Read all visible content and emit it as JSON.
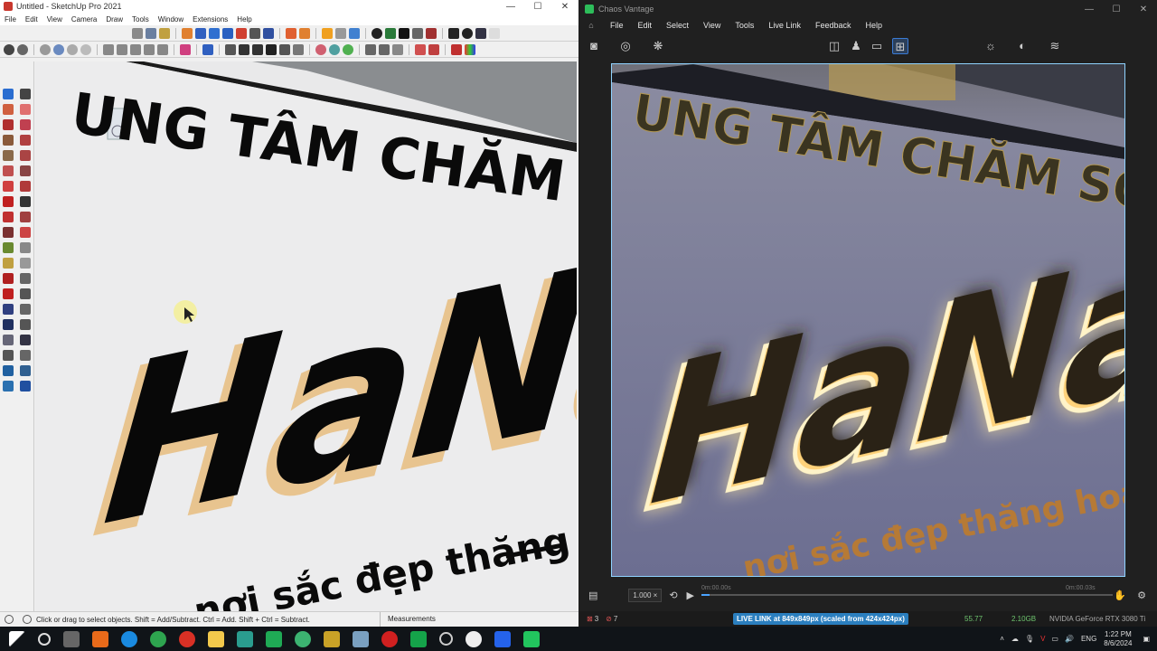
{
  "sketchup": {
    "title": "Untitled - SketchUp Pro 2021",
    "window_controls": [
      "—",
      "☐",
      "✕"
    ],
    "menu": [
      "File",
      "Edit",
      "View",
      "Camera",
      "Draw",
      "Tools",
      "Window",
      "Extensions",
      "Help"
    ],
    "status_text": "Click or drag to select objects. Shift = Add/Subtract. Ctrl = Add. Shift + Ctrl = Subtract.",
    "measurements_label": "Measurements"
  },
  "sign": {
    "heading": "UNG TÂM CHĂM SÓC S",
    "brand": "HaNa Sp",
    "tagline": "nơi sắc đẹp thăng hoa"
  },
  "vantage": {
    "title": "Chaos Vantage",
    "menu": [
      "File",
      "Edit",
      "Select",
      "View",
      "Tools",
      "Live Link",
      "Feedback",
      "Help"
    ],
    "zoom": "1.000 ×",
    "time_start": "0m:00.00s",
    "time_end": "0m:00.03s",
    "errors": "3",
    "warnings": "7",
    "live_link": "LIVE LINK at 849x849px (scaled from 424x424px)",
    "fps": "55.77",
    "memory": "2.10GB",
    "gpu": "NVIDIA GeForce RTX 3080 Ti",
    "timeline_progress": 0.02
  },
  "taskbar": {
    "time": "1:22 PM",
    "date": "8/6/2024",
    "language": "ENG"
  },
  "colors": {
    "vantage_accent": "#8fd3ff",
    "live_link_bg": "#2b7fbf",
    "glow": "#ffd27a"
  }
}
